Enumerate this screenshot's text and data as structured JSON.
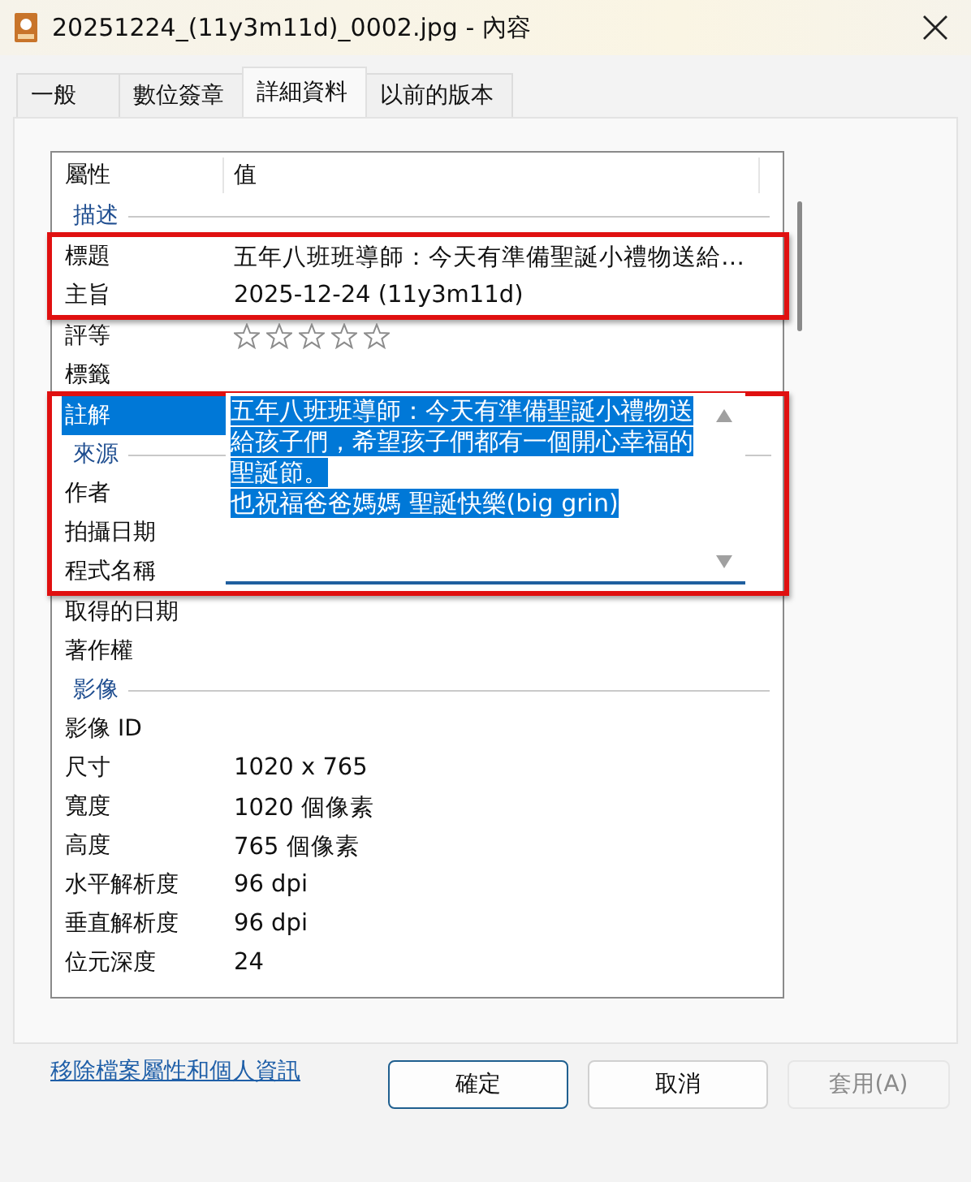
{
  "window": {
    "title": "20251224_(11y3m11d)_0002.jpg - 內容"
  },
  "tabs": [
    {
      "label": "一般",
      "selected": false
    },
    {
      "label": "數位簽章",
      "selected": false
    },
    {
      "label": "詳細資料",
      "selected": true
    },
    {
      "label": "以前的版本",
      "selected": false
    }
  ],
  "details": {
    "columns": [
      "屬性",
      "值"
    ],
    "blocks": [
      {
        "framed": false,
        "items": [
          {
            "kind": "section",
            "label": "描述"
          }
        ]
      },
      {
        "framed": true,
        "items": [
          {
            "kind": "row",
            "label": "標題",
            "value": "五年八班班導師：今天有準備聖誕小禮物送給…",
            "selected": false
          },
          {
            "kind": "row",
            "label": "主旨",
            "value": "2025-12-24 (11y3m11d)",
            "selected": false
          }
        ]
      },
      {
        "framed": false,
        "items": [
          {
            "kind": "rating",
            "label": "評等",
            "stars": 0,
            "selected": false
          },
          {
            "kind": "row",
            "label": "標籤",
            "selected": false
          }
        ]
      },
      {
        "framed": true,
        "items": [
          {
            "kind": "row",
            "label": "註解",
            "selected": true
          },
          {
            "kind": "section",
            "label": "來源"
          },
          {
            "kind": "row",
            "label": "作者",
            "selected": false
          },
          {
            "kind": "row",
            "label": "拍攝日期",
            "selected": false
          },
          {
            "kind": "row",
            "label": "程式名稱",
            "selected": false
          }
        ],
        "editor": {
          "paragraphs": [
            "五年八班班導師：今天有準備聖誕小禮物送給孩子們，希望孩子們都有一個開心幸福的聖誕節。",
            "也祝福爸爸媽媽 聖誕快樂(big grin)"
          ],
          "selected": true
        }
      },
      {
        "framed": false,
        "items": [
          {
            "kind": "row",
            "label": "取得的日期",
            "selected": false
          },
          {
            "kind": "row",
            "label": "著作權",
            "selected": false
          },
          {
            "kind": "section",
            "label": "影像"
          },
          {
            "kind": "row",
            "label": "影像 ID",
            "selected": false
          },
          {
            "kind": "row",
            "label": "尺寸",
            "value": "1020 x 765",
            "selected": false
          },
          {
            "kind": "row",
            "label": "寬度",
            "value": "1020 個像素",
            "selected": false
          },
          {
            "kind": "row",
            "label": "高度",
            "value": "765 個像素",
            "selected": false
          },
          {
            "kind": "row",
            "label": "水平解析度",
            "value": "96 dpi",
            "selected": false
          },
          {
            "kind": "row",
            "label": "垂直解析度",
            "value": "96 dpi",
            "selected": false
          },
          {
            "kind": "row",
            "label": "位元深度",
            "value": "24",
            "selected": false
          }
        ]
      }
    ]
  },
  "link": "移除檔案屬性和個人資訊",
  "buttons": [
    {
      "label": "確定",
      "kind": "default",
      "disabled": false
    },
    {
      "label": "取消",
      "kind": "normal",
      "disabled": false
    },
    {
      "label": "套用(A)",
      "kind": "normal",
      "disabled": true
    }
  ]
}
